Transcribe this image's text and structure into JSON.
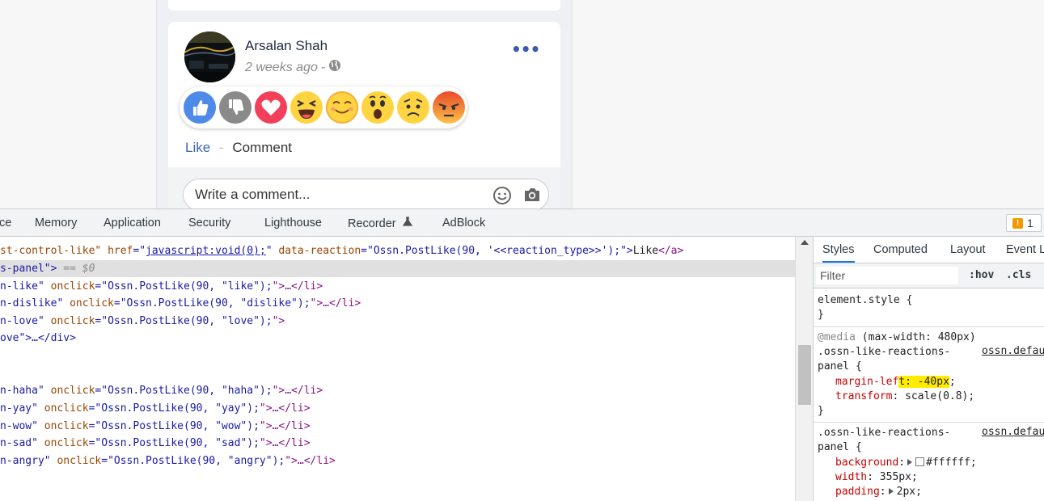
{
  "post": {
    "author": "Arsalan Shah",
    "time": "2 weeks ago",
    "meta_sep": "-",
    "more": "•••",
    "reactions": [
      "like",
      "dislike",
      "love",
      "haha",
      "yay",
      "wow",
      "sad",
      "angry"
    ],
    "like_label": "Like",
    "action_sep": "-",
    "comment_label": "Comment",
    "comment_placeholder": "Write a comment..."
  },
  "devtools": {
    "tabs": [
      "ce",
      "Memory",
      "Application",
      "Security",
      "Lighthouse",
      "Recorder",
      "AdBlock"
    ],
    "issues_count": "1",
    "elements": {
      "l1": {
        "a1": "st-control-like\" ",
        "n1": "href",
        "eq1": "=\"",
        "v1": "javascript:void(0);",
        "q1": "\" ",
        "n2": "data-reaction",
        "eq2": "=\"",
        "v2": "Ossn.PostLike(90, '<<reaction_type>>');",
        "q2": "\">",
        "text": "Like",
        "close": "</a>"
      },
      "l2": {
        "a": "s-panel\">",
        "dim": " == $0"
      },
      "l3": {
        "a": "n-like\" ",
        "n": "onclick",
        "eq": "=\"",
        "v": "Ossn.PostLike(90, \"like\");",
        "end": "\">…</li>"
      },
      "l4": {
        "a": "n-dislike\" ",
        "n": "onclick",
        "eq": "=\"",
        "v": "Ossn.PostLike(90, \"dislike\");",
        "end": "\">…</li>"
      },
      "l5": {
        "a": "n-love\" ",
        "n": "onclick",
        "eq": "=\"",
        "v": "Ossn.PostLike(90, \"love\");",
        "end": "\">"
      },
      "l6": {
        "a": "ove\">…</div>"
      },
      "l7": {
        "a": "n-haha\" ",
        "n": "onclick",
        "eq": "=\"",
        "v": "Ossn.PostLike(90, \"haha\");",
        "end": "\">…</li>"
      },
      "l8": {
        "a": "n-yay\" ",
        "n": "onclick",
        "eq": "=\"",
        "v": "Ossn.PostLike(90, \"yay\");",
        "end": "\">…</li>"
      },
      "l9": {
        "a": "n-wow\" ",
        "n": "onclick",
        "eq": "=\"",
        "v": "Ossn.PostLike(90, \"wow\");",
        "end": "\">…</li>"
      },
      "l10": {
        "a": "n-sad\" ",
        "n": "onclick",
        "eq": "=\"",
        "v": "Ossn.PostLike(90, \"sad\");",
        "end": "\">…</li>"
      },
      "l11": {
        "a": "n-angry\" ",
        "n": "onclick",
        "eq": "=\"",
        "v": "Ossn.PostLike(90, \"angry\");",
        "end": "\">…</li>"
      }
    },
    "styles": {
      "tabs": [
        "Styles",
        "Computed",
        "Layout",
        "Event L"
      ],
      "filter_placeholder": "Filter",
      "hov": ":hov",
      "cls": ".cls",
      "element_style": "element.style {",
      "close_brace": "}",
      "media_at": "@media",
      "media_query": " (max-width: 480px)",
      "selector_line1": ".ossn-like-reactions-",
      "selector_line2": "panel {",
      "source": "ossn.defau",
      "rule1": [
        {
          "prop": "margin-lef",
          "hl": "t: -40px",
          "tail": ";"
        },
        {
          "prop": "transform",
          "val": ": scale(0.8);"
        }
      ],
      "rule2": [
        {
          "prop": "background",
          "val": "#ffffff;"
        },
        {
          "prop": "width",
          "val": ": 355px;"
        },
        {
          "prop": "padding",
          "val": "2px;"
        }
      ]
    }
  },
  "colors": {
    "accent_blue": "#1a73e8",
    "link_blue": "#3a64b8",
    "highlight": "#ffec00",
    "tag_purple": "#881280",
    "attr_name": "#994500",
    "attr_value": "#1a1aa6",
    "css_prop": "#c80000"
  }
}
